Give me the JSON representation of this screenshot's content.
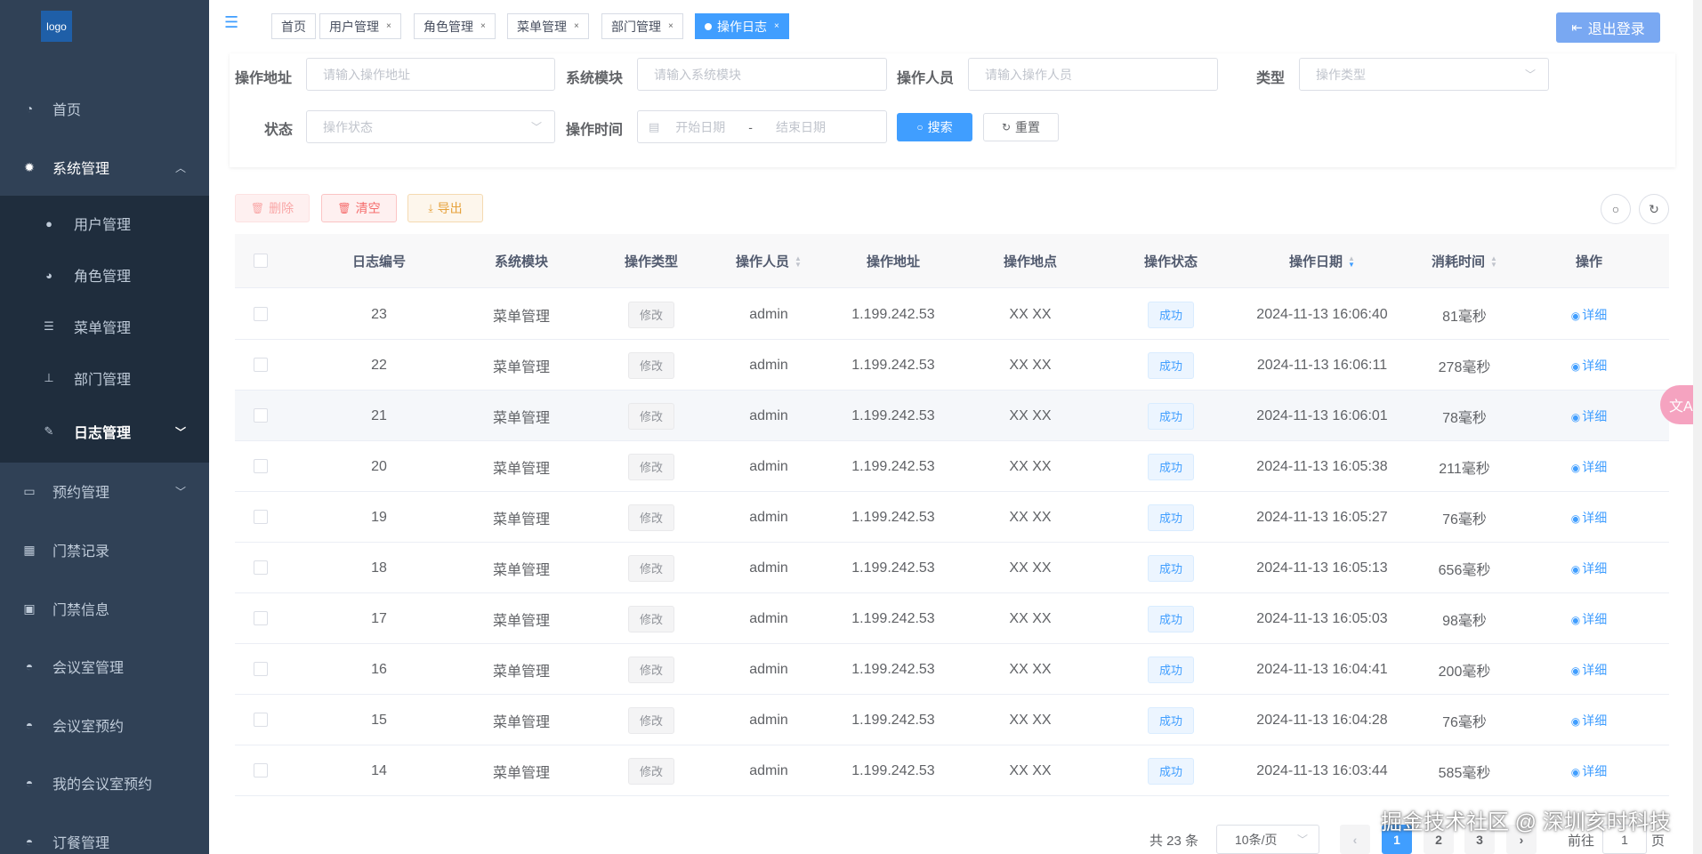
{
  "logo": "logo",
  "sidebar": {
    "items": [
      {
        "label": "首页",
        "icon": "dashboard-icon"
      },
      {
        "label": "系统管理",
        "icon": "gear-icon"
      },
      {
        "label": "预约管理",
        "icon": "card-icon"
      },
      {
        "label": "门禁记录",
        "icon": "grid-icon"
      },
      {
        "label": "门禁信息",
        "icon": "monitor-icon"
      },
      {
        "label": "会议室管理",
        "icon": "chair-icon"
      },
      {
        "label": "会议室预约",
        "icon": "chair-icon"
      },
      {
        "label": "我的会议室预约",
        "icon": "chair-icon"
      },
      {
        "label": "订餐管理",
        "icon": "chair-icon"
      }
    ],
    "sub_items": [
      {
        "label": "用户管理",
        "icon": "user-icon"
      },
      {
        "label": "角色管理",
        "icon": "role-icon"
      },
      {
        "label": "菜单管理",
        "icon": "tree-list-icon"
      },
      {
        "label": "部门管理",
        "icon": "org-icon"
      },
      {
        "label": "日志管理",
        "icon": "edit-icon"
      }
    ]
  },
  "tabs": [
    {
      "label": "首页"
    },
    {
      "label": "用户管理"
    },
    {
      "label": "角色管理"
    },
    {
      "label": "菜单管理"
    },
    {
      "label": "部门管理"
    },
    {
      "label": "操作日志"
    }
  ],
  "logout_label": "退出登录",
  "search": {
    "addr_label": "操作地址",
    "addr_placeholder": "请输入操作地址",
    "module_label": "系统模块",
    "module_placeholder": "请输入系统模块",
    "person_label": "操作人员",
    "person_placeholder": "请输入操作人员",
    "type_label": "类型",
    "type_placeholder": "操作类型",
    "status_label": "状态",
    "status_placeholder": "操作状态",
    "time_label": "操作时间",
    "start_placeholder": "开始日期",
    "range_sep": "-",
    "end_placeholder": "结束日期",
    "search_btn": "搜索",
    "reset_btn": "重置"
  },
  "actions": {
    "delete": "删除",
    "clear": "清空",
    "export": "导出"
  },
  "table": {
    "headers": [
      "日志编号",
      "系统模块",
      "操作类型",
      "操作人员",
      "操作地址",
      "操作地点",
      "操作状态",
      "操作日期",
      "消耗时间",
      "操作"
    ],
    "rows": [
      [
        "23",
        "菜单管理",
        "修改",
        "admin",
        "1.199.242.53",
        "XX XX",
        "成功",
        "2024-11-13 16:06:40",
        "81毫秒",
        "详细"
      ],
      [
        "22",
        "菜单管理",
        "修改",
        "admin",
        "1.199.242.53",
        "XX XX",
        "成功",
        "2024-11-13 16:06:11",
        "278毫秒",
        "详细"
      ],
      [
        "21",
        "菜单管理",
        "修改",
        "admin",
        "1.199.242.53",
        "XX XX",
        "成功",
        "2024-11-13 16:06:01",
        "78毫秒",
        "详细"
      ],
      [
        "20",
        "菜单管理",
        "修改",
        "admin",
        "1.199.242.53",
        "XX XX",
        "成功",
        "2024-11-13 16:05:38",
        "211毫秒",
        "详细"
      ],
      [
        "19",
        "菜单管理",
        "修改",
        "admin",
        "1.199.242.53",
        "XX XX",
        "成功",
        "2024-11-13 16:05:27",
        "76毫秒",
        "详细"
      ],
      [
        "18",
        "菜单管理",
        "修改",
        "admin",
        "1.199.242.53",
        "XX XX",
        "成功",
        "2024-11-13 16:05:13",
        "656毫秒",
        "详细"
      ],
      [
        "17",
        "菜单管理",
        "修改",
        "admin",
        "1.199.242.53",
        "XX XX",
        "成功",
        "2024-11-13 16:05:03",
        "98毫秒",
        "详细"
      ],
      [
        "16",
        "菜单管理",
        "修改",
        "admin",
        "1.199.242.53",
        "XX XX",
        "成功",
        "2024-11-13 16:04:41",
        "200毫秒",
        "详细"
      ],
      [
        "15",
        "菜单管理",
        "修改",
        "admin",
        "1.199.242.53",
        "XX XX",
        "成功",
        "2024-11-13 16:04:28",
        "76毫秒",
        "详细"
      ],
      [
        "14",
        "菜单管理",
        "修改",
        "admin",
        "1.199.242.53",
        "XX XX",
        "成功",
        "2024-11-13 16:03:44",
        "585毫秒",
        "详细"
      ]
    ]
  },
  "pagination": {
    "total": "共 23 条",
    "page_size": "10条/页",
    "pages": [
      "1",
      "2",
      "3"
    ],
    "goto_label": "前往",
    "goto_value": "1",
    "page_suffix": "页"
  },
  "watermark": "掘金技术社区 @ 深圳亥时科技",
  "colors": {
    "sidebar": "#304156",
    "primary": "#409eff",
    "danger": "#f56c6c",
    "warning": "#e6a23c"
  }
}
